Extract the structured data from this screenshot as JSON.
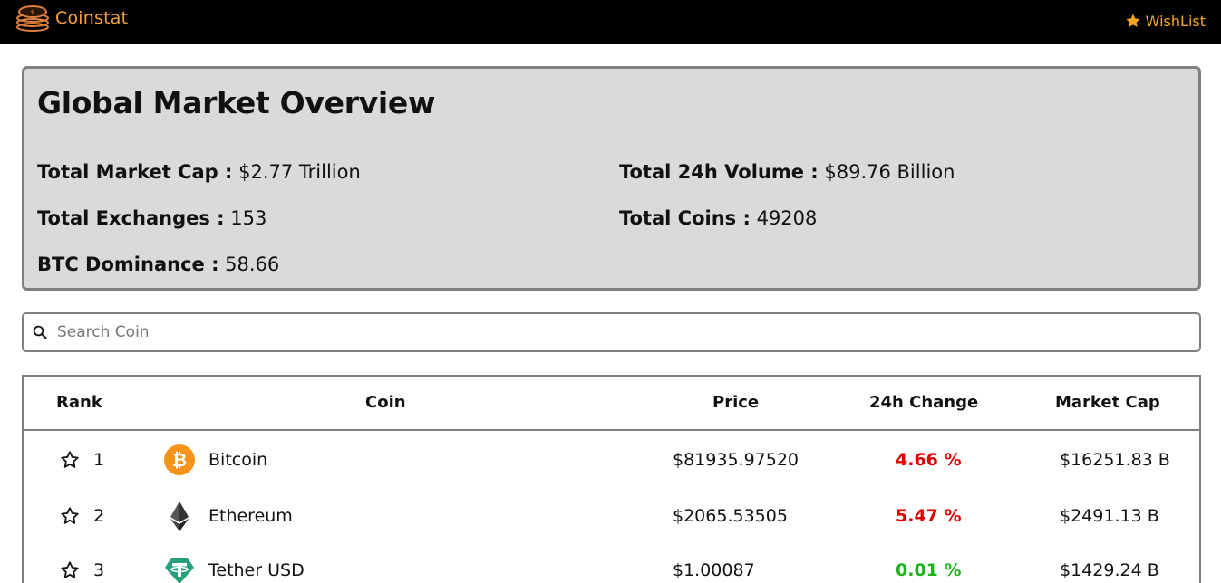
{
  "header": {
    "brand": "Coinstat",
    "wishlist_label": "WishList",
    "accent_color": "#f5a623"
  },
  "overview": {
    "title": "Global Market Overview",
    "stats": [
      {
        "label": "Total Market Cap :",
        "value": "$2.77 Trillion"
      },
      {
        "label": "Total 24h Volume :",
        "value": "$89.76 Billion"
      },
      {
        "label": "Total Exchanges :",
        "value": "153"
      },
      {
        "label": "Total Coins :",
        "value": "49208"
      },
      {
        "label": "BTC Dominance :",
        "value": "58.66"
      }
    ]
  },
  "search": {
    "placeholder": "Search Coin",
    "value": ""
  },
  "table": {
    "columns": [
      "Rank",
      "Coin",
      "Price",
      "24h Change",
      "Market Cap"
    ],
    "rows": [
      {
        "rank": "1",
        "name": "Bitcoin",
        "icon": "bitcoin-icon",
        "price": "$81935.97520",
        "change": "4.66 %",
        "change_color": "#e00000",
        "market_cap": "$16251.83 B"
      },
      {
        "rank": "2",
        "name": "Ethereum",
        "icon": "ethereum-icon",
        "price": "$2065.53505",
        "change": "5.47 %",
        "change_color": "#e00000",
        "market_cap": "$2491.13 B"
      },
      {
        "rank": "3",
        "name": "Tether USD",
        "icon": "tether-icon",
        "price": "$1.00087",
        "change": "0.01 %",
        "change_color": "#1db31d",
        "market_cap": "$1429.24 B"
      }
    ]
  }
}
